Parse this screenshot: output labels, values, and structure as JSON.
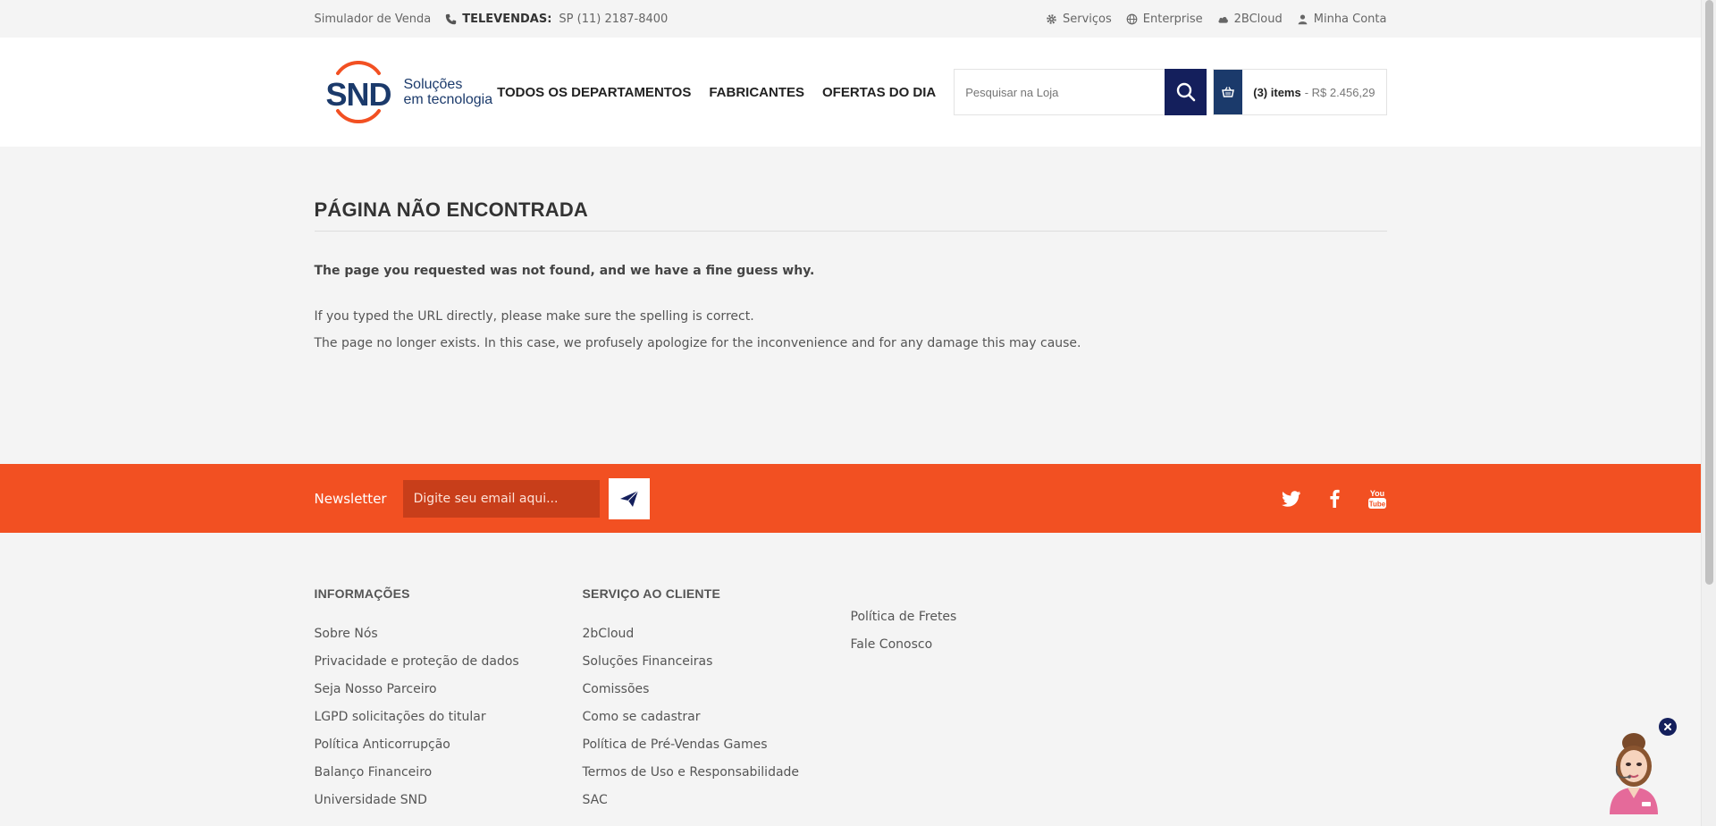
{
  "topbar": {
    "left": {
      "simulator": "Simulador de Venda",
      "phone_label": "TELEVENDAS:",
      "phone_value": "SP (11)  2187-8400"
    },
    "right": {
      "servicos": "Serviços",
      "enterprise": "Enterprise",
      "cloud": "2BCloud",
      "account": "Minha Conta"
    }
  },
  "header": {
    "logo": {
      "mark": "SND",
      "line1": "Soluções",
      "line2": "em tecnologia"
    },
    "nav": [
      "TODOS OS DEPARTAMENTOS",
      "FABRICANTES",
      "OFERTAS DO DIA"
    ],
    "search": {
      "placeholder": "Pesquisar na Loja"
    },
    "cart": {
      "items": "(3) items",
      "price": "- R$ 2.456,29"
    }
  },
  "content": {
    "title": "PÁGINA NÃO ENCONTRADA",
    "lead": "The page you requested was not found, and we have a fine guess why.",
    "paragraphs": [
      "If you typed the URL directly, please make sure the spelling is correct.",
      "The page no longer exists. In this case, we profusely apologize for the inconvenience and for any damage this may cause."
    ]
  },
  "newsletter": {
    "label": "Newsletter",
    "placeholder": "Digite seu email aqui..."
  },
  "footer": {
    "col1": {
      "title": "INFORMAÇÕES",
      "links": [
        "Sobre Nós",
        "Privacidade e proteção de dados",
        "Seja Nosso Parceiro",
        "LGPD solicitações do titular",
        "Política Anticorrupção",
        "Balanço Financeiro",
        "Universidade SND"
      ]
    },
    "col2": {
      "title": "SERVIÇO AO CLIENTE",
      "links": [
        "2bCloud",
        "Soluções Financeiras",
        "Comissões",
        "Como se cadastrar",
        "Política de Pré-Vendas Games",
        "Termos de Uso e Responsabilidade",
        "SAC"
      ]
    },
    "col3": {
      "links": [
        "Política de Fretes",
        "Fale Conosco"
      ]
    }
  },
  "colors": {
    "brand_navy": "#141f5c",
    "brand_blue": "#1b3a6b",
    "brand_orange": "#f25022"
  }
}
